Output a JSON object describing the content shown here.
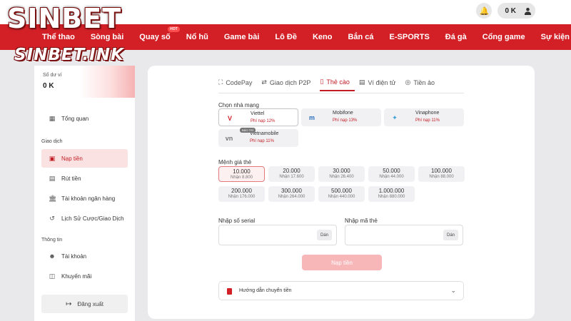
{
  "brand": {
    "logo_text": "SINBET",
    "domain_text": "SINBET.INK",
    "accent": "#d32027"
  },
  "header": {
    "balance": "0 K",
    "icons": {
      "notifications": "bell-icon",
      "deposit": "plus-icon",
      "account": "user-icon"
    }
  },
  "nav": {
    "items": [
      {
        "label": "Thể thao"
      },
      {
        "label": "Sòng bài"
      },
      {
        "label": "Quay số",
        "badge": "HOT"
      },
      {
        "label": "Nổ hũ"
      },
      {
        "label": "Game bài"
      },
      {
        "label": "Lô Đề"
      },
      {
        "label": "Keno"
      },
      {
        "label": "Bắn cá"
      },
      {
        "label": "E-SPORTS"
      },
      {
        "label": "Đá gà"
      },
      {
        "label": "Cổng game"
      },
      {
        "label": "Sự kiện"
      }
    ]
  },
  "sidebar": {
    "wallet_label": "Số dư ví",
    "wallet_value": "0 K",
    "overview": "Tổng quan",
    "section_transactions": "Giao dịch",
    "deposit": "Nạp tiền",
    "withdraw": "Rút tiền",
    "bank_account": "Tài khoản ngân hàng",
    "history": "Lịch Sử Cược/Giao Dịch",
    "section_info": "Thông tin",
    "account": "Tài khoản",
    "promotions": "Khuyến mãi",
    "logout": "Đăng xuất"
  },
  "tabs": [
    {
      "label": "CodePay",
      "icon": "scan-icon",
      "active": false
    },
    {
      "label": "Giao dịch P2P",
      "icon": "exchange-icon",
      "active": false
    },
    {
      "label": "Thẻ cào",
      "icon": "card-icon",
      "active": true
    },
    {
      "label": "Ví điện tử",
      "icon": "wallet-icon",
      "active": false
    },
    {
      "label": "Tiền ảo",
      "icon": "coin-icon",
      "active": false
    }
  ],
  "form": {
    "network_label": "Chọn nhà mạng",
    "networks": [
      {
        "name": "Viettel",
        "fee": "Phí nạp 12%",
        "logo": "V",
        "logo_color": "#d32027",
        "active": true
      },
      {
        "name": "Mobifone",
        "fee": "Phí nạp 13%",
        "logo": "m",
        "logo_color": "#2a6fbf",
        "active": false
      },
      {
        "name": "Vinaphone",
        "fee": "Phí nạp 11%",
        "logo": "✦",
        "logo_color": "#3aa0d8",
        "active": false
      },
      {
        "name": "Vietnamobile",
        "fee": "Phí nạp 11%",
        "logo": "vn",
        "logo_color": "#777777",
        "badge": "BẢO TRÌ",
        "active": false
      }
    ],
    "amount_label": "Mệnh giá thẻ",
    "amounts": [
      {
        "value": "10.000",
        "receive": "Nhận 8.800",
        "active": true
      },
      {
        "value": "20.000",
        "receive": "Nhận 17.600"
      },
      {
        "value": "30.000",
        "receive": "Nhận 26.400"
      },
      {
        "value": "50.000",
        "receive": "Nhận 44.000"
      },
      {
        "value": "100.000",
        "receive": "Nhận 88.000"
      },
      {
        "value": "200.000",
        "receive": "Nhận 176.000"
      },
      {
        "value": "300.000",
        "receive": "Nhận 264.000"
      },
      {
        "value": "500.000",
        "receive": "Nhận 440.000"
      },
      {
        "value": "1.000.000",
        "receive": "Nhận 880.000"
      }
    ],
    "serial_label": "Nhập số serial",
    "code_label": "Nhập mã thẻ",
    "paste": "Dán",
    "submit": "Nạp tiền",
    "guide": "Hướng dẫn chuyển tiền"
  }
}
